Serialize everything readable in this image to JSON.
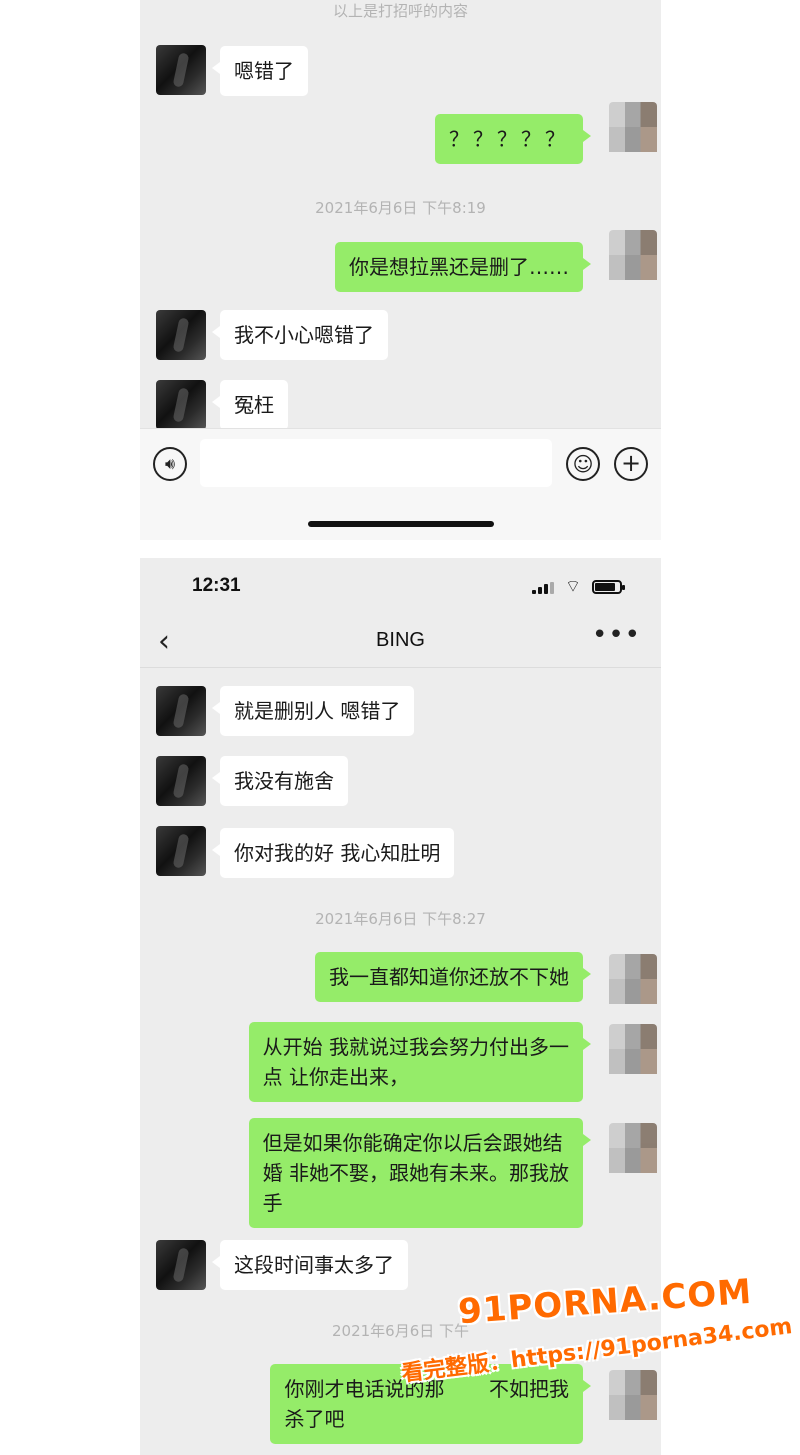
{
  "top_chat": {
    "system_notice": "以上是打招呼的内容",
    "timestamp": "2021年6月6日 下午8:19",
    "messages": [
      {
        "side": "left",
        "text": "嗯错了"
      },
      {
        "side": "right",
        "text": "？？？？？"
      },
      {
        "side": "right",
        "text": "你是想拉黑还是删了……"
      },
      {
        "side": "left",
        "text": "我不小心嗯错了"
      },
      {
        "side": "left",
        "text": "冤枉"
      }
    ],
    "input": {
      "voice_icon": "voice-icon",
      "emoji_icon": "emoji-icon",
      "plus_icon": "plus-icon"
    }
  },
  "bottom_chat": {
    "status_bar": {
      "time": "12:31"
    },
    "nav": {
      "title": "BING",
      "back_glyph": "‹",
      "more_glyph": "•••"
    },
    "timestamps": [
      "2021年6月6日 下午8:27",
      "2021年6月6日 下午"
    ],
    "messages": [
      {
        "side": "left",
        "text": "就是删别人 嗯错了"
      },
      {
        "side": "left",
        "text": "我没有施舍"
      },
      {
        "side": "left",
        "text": "你对我的好 我心知肚明"
      },
      {
        "side": "right",
        "text": "我一直都知道你还放不下她"
      },
      {
        "side": "right",
        "text": "从开始 我就说过我会努力付出多一\n点 让你走出来，"
      },
      {
        "side": "right",
        "text": "但是如果你能确定你以后会跟她结\n婚 非她不娶，跟她有未来。那我放\n手"
      },
      {
        "side": "left",
        "text": "这段时间事太多了"
      },
      {
        "side": "right",
        "text": "你刚才电话说的那       不如把我\n杀了吧"
      }
    ]
  },
  "watermark": {
    "logo": "91PORNA.COM",
    "url": "看完整版：https://91porna34.com"
  },
  "colors": {
    "bubble_green": "#95ec69",
    "chat_bg": "#ededed",
    "watermark": "#ff6a00"
  }
}
